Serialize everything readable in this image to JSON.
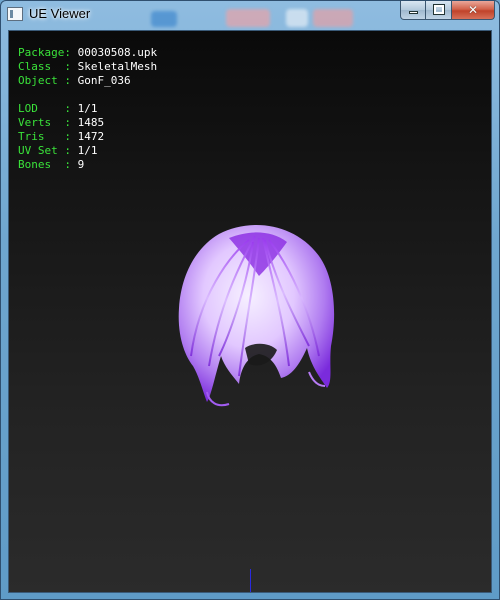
{
  "window": {
    "title": "UE Viewer",
    "buttons": {
      "minimize_icon": "minimize-icon",
      "maximize_icon": "maximize-icon",
      "close_glyph": "✕"
    }
  },
  "info": {
    "rows": [
      {
        "label": "Package:",
        "value": "00030508.upk"
      },
      {
        "label": "Class  :",
        "value": "SkeletalMesh"
      },
      {
        "label": "Object :",
        "value": "GonF_036"
      },
      {
        "label": "LOD    :",
        "value": "1/1"
      },
      {
        "label": "Verts  :",
        "value": "1485"
      },
      {
        "label": "Tris   :",
        "value": "1472"
      },
      {
        "label": "UV Set :",
        "value": "1/1"
      },
      {
        "label": "Bones  :",
        "value": "9"
      }
    ]
  },
  "colors": {
    "label": "#3ae33a",
    "value": "#ffffff",
    "mesh_primary": "#8a2be2",
    "mesh_highlight": "#f2e9ff"
  }
}
